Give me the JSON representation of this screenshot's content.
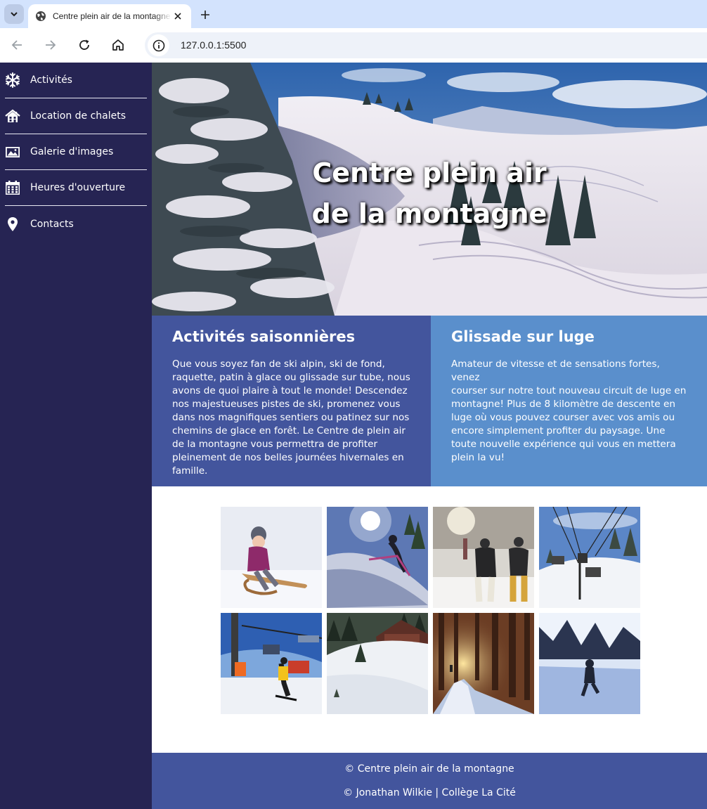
{
  "browser": {
    "tab_title": "Centre plein air de la montagne",
    "url": "127.0.0.1:5500"
  },
  "sidebar": {
    "items": [
      {
        "label": "Activités",
        "icon": "snowflake-icon"
      },
      {
        "label": "Location de chalets",
        "icon": "house-icon"
      },
      {
        "label": "Galerie d'images",
        "icon": "image-icon"
      },
      {
        "label": "Heures d'ouverture",
        "icon": "calendar-icon"
      },
      {
        "label": "Contacts",
        "icon": "location-pin-icon"
      }
    ]
  },
  "hero": {
    "title_line1": "Centre plein air",
    "title_line2": "de la montagne"
  },
  "panels": [
    {
      "title": "Activités saisonnières",
      "lines": [
        "Que vous soyez fan de ski alpin, ski de fond,",
        "raquette, patin à glace ou glissade sur tube, nous",
        "avons de quoi plaire à tout le monde! Descendez",
        "nos majestueuses pistes de ski, promenez vous",
        "dans nos magnifiques sentiers ou patinez sur nos",
        "chemins de glace en forêt. Le Centre de plein air",
        "de la montagne vous permettra de profiter",
        "pleinement de nos belles journées hivernales en",
        "famille."
      ]
    },
    {
      "title": "Glissade sur luge",
      "lines": [
        "Amateur de vitesse et de sensations fortes, venez",
        "courser sur notre tout nouveau circuit de luge en",
        "montagne! Plus de 8 kilomètre de descente en",
        "luge où vous pouvez courser avec vos amis ou",
        "encore simplement profiter du paysage. Une",
        "toute nouvelle expérience qui vous en mettera",
        "plein la vu!"
      ]
    }
  ],
  "footer": {
    "line1": "© Centre plein air de la montagne",
    "line2": "© Jonathan Wilkie | Collège La Cité"
  },
  "colors": {
    "sidebar": "#262453",
    "panel_left": "#43559d",
    "panel_right": "#5a8fcc",
    "footer": "#43559d"
  }
}
